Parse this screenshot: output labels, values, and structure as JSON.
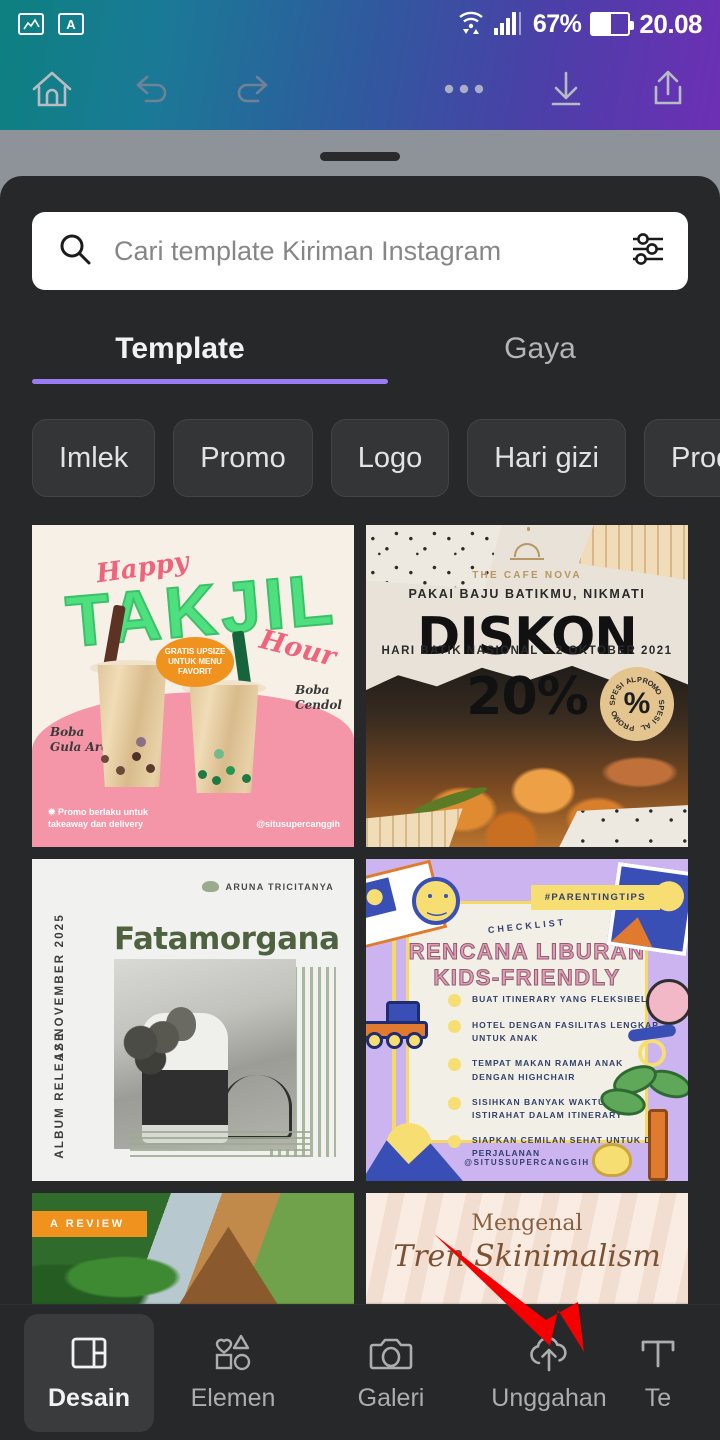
{
  "statusbar": {
    "icons": [
      "image-icon",
      "app-badge-icon"
    ],
    "wifi": "wifi-icon",
    "signal": "signal-bars-icon",
    "battery_percent": "67%",
    "battery_icon": "battery-icon",
    "time": "20.08"
  },
  "toolbar": {
    "home": "home-icon",
    "undo": "undo-icon",
    "redo": "redo-icon",
    "more": "more-options-icon",
    "download": "download-icon",
    "share": "share-icon"
  },
  "sheet": {
    "handle": "drag-handle"
  },
  "search": {
    "placeholder": "Cari template Kiriman Instagram",
    "value": "",
    "search_icon": "search-icon",
    "filter_icon": "filter-sliders-icon"
  },
  "tabs": {
    "items": [
      {
        "label": "Template",
        "active": true
      },
      {
        "label": "Gaya",
        "active": false
      }
    ],
    "accent_color": "#9b7bf5"
  },
  "chips": [
    {
      "label": "Imlek"
    },
    {
      "label": "Promo"
    },
    {
      "label": "Logo"
    },
    {
      "label": "Hari gizi"
    },
    {
      "label": "Produk"
    }
  ],
  "templates": [
    {
      "id": "takjil",
      "happy": "Happy",
      "title": "TAKJIL",
      "hour": "Hour",
      "badge_line1": "GRATIS UPSIZE",
      "badge_line2": "UNTUK MENU",
      "badge_line3": "FAVORIT",
      "label_left_1": "Boba",
      "label_left_2": "Gula Aren",
      "label_right_1": "Boba",
      "label_right_2": "Cendol",
      "footer_1": "✹ Promo berlaku untuk",
      "footer_2": "takeaway dan delivery",
      "handle": "@situsupercanggih"
    },
    {
      "id": "diskon",
      "brand": "THE CAFE NOVA",
      "supertitle": "PAKAI BAJU BATIKMU, NIKMATI",
      "headline": "DISKON 20%",
      "subtitle": "HARI BATIK NASIONAL – 2 OKTOBER 2021",
      "seal_text": "PROMO SPESIAL PROMO SPESIAL",
      "seal_symbol": "%"
    },
    {
      "id": "fatamorgana",
      "brand": "ARUNA TRICITANYA",
      "date": "12 NOVEMBER 2025",
      "release": "ALBUM RELEASE",
      "title": "Fatamorgana"
    },
    {
      "id": "liburan",
      "tag": "#PARENTINGTIPS",
      "eyebrow": "CHECKLIST",
      "title_line1": "RENCANA LIBURAN",
      "title_line2": "KIDS-FRIENDLY",
      "items": [
        "BUAT ITINERARY YANG FLEKSIBEL",
        "HOTEL DENGAN FASILITAS LENGKAP UNTUK ANAK",
        "TEMPAT MAKAN RAMAH ANAK DENGAN HIGHCHAIR",
        "SISIHKAN BANYAK WAKTU ISTIRAHAT DALAM ITINERARY",
        "SIAPKAN CEMILAN SEHAT UNTUK DI PERJALANAN"
      ],
      "handle": "@SITUSSUPERCANGGIH"
    },
    {
      "id": "review",
      "badge": "A REVIEW"
    },
    {
      "id": "skinimalism",
      "line1": "Mengenal",
      "line2": "Tren Skinimalism"
    }
  ],
  "bottomnav": {
    "items": [
      {
        "label": "Desain",
        "icon": "layout-panels-icon",
        "active": true
      },
      {
        "label": "Elemen",
        "icon": "shapes-icon",
        "active": false
      },
      {
        "label": "Galeri",
        "icon": "camera-icon",
        "active": false
      },
      {
        "label": "Unggahan",
        "icon": "cloud-upload-icon",
        "active": false
      },
      {
        "label": "Te",
        "icon": "text-icon",
        "active": false
      }
    ]
  },
  "annotation": {
    "arrow": "red-arrow-pointing-to-unggahan",
    "color": "#f50000"
  }
}
